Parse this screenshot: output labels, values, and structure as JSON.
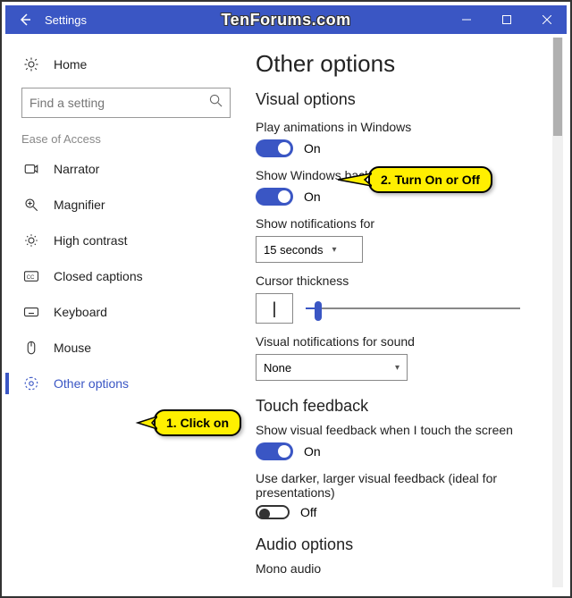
{
  "titlebar": {
    "title": "Settings"
  },
  "watermark": "TenForums.com",
  "sidebar": {
    "home": "Home",
    "search_placeholder": "Find a setting",
    "section": "Ease of Access",
    "items": [
      {
        "label": "Narrator"
      },
      {
        "label": "Magnifier"
      },
      {
        "label": "High contrast"
      },
      {
        "label": "Closed captions"
      },
      {
        "label": "Keyboard"
      },
      {
        "label": "Mouse"
      },
      {
        "label": "Other options"
      }
    ]
  },
  "main": {
    "title": "Other options",
    "visual": {
      "heading": "Visual options",
      "anim_label": "Play animations in Windows",
      "anim_state": "On",
      "bg_label": "Show Windows background",
      "bg_state": "On",
      "notif_label": "Show notifications for",
      "notif_value": "15 seconds",
      "cursor_label": "Cursor thickness",
      "cursor_sample": "|",
      "visnotif_label": "Visual notifications for sound",
      "visnotif_value": "None"
    },
    "touch": {
      "heading": "Touch feedback",
      "show_label": "Show visual feedback when I touch the screen",
      "show_state": "On",
      "dark_label": "Use darker, larger visual feedback (ideal for presentations)",
      "dark_state": "Off"
    },
    "audio": {
      "heading": "Audio options",
      "mono_label": "Mono audio"
    }
  },
  "callouts": {
    "c1": "1. Click on",
    "c2": "2. Turn On or Off"
  }
}
